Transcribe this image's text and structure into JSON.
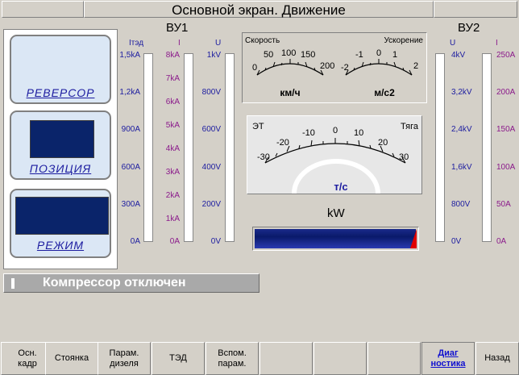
{
  "header": {
    "title": "Основной экран. Движение"
  },
  "left_panel": {
    "reverser_label": "РЕВЕРСОР",
    "position_label": "ПОЗИЦИЯ",
    "mode_label": "РЕЖИМ"
  },
  "vu1": {
    "title": "ВУ1",
    "col_ited": "Iтэд",
    "col_i": "I",
    "col_u": "U",
    "ited_scale": [
      "1,5kA",
      "1,2kA",
      "900A",
      "600A",
      "300A",
      "0A"
    ],
    "i_scale": [
      "8kA",
      "7kA",
      "6kA",
      "5kA",
      "4kA",
      "3kA",
      "2kA",
      "1kA",
      "0A"
    ],
    "u_scale": [
      "1kV",
      "800V",
      "600V",
      "400V",
      "200V",
      "0V"
    ]
  },
  "vu2": {
    "title": "ВУ2",
    "col_u": "U",
    "col_i": "I",
    "u_scale": [
      "4kV",
      "3,2kV",
      "2,4kV",
      "1,6kV",
      "800V",
      "0V"
    ],
    "i_scale": [
      "250A",
      "200A",
      "150A",
      "100A",
      "50A",
      "0A"
    ]
  },
  "speed_gauge": {
    "title": "Скорость",
    "ticks": [
      "0",
      "50",
      "100",
      "150",
      "200"
    ],
    "unit": "км/ч"
  },
  "accel_gauge": {
    "title": "Ускорение",
    "ticks": [
      "-2",
      "-1",
      "0",
      "1",
      "2"
    ],
    "unit": "м/с2"
  },
  "traction_gauge": {
    "left_label": "ЭТ",
    "right_label": "Тяга",
    "ticks": [
      "-30",
      "-20",
      "-10",
      "0",
      "10",
      "20",
      "30"
    ],
    "unit": "т/с"
  },
  "power": {
    "title": "kW",
    "bar_fill": 1.0
  },
  "status": {
    "text": "Компрессор отключен"
  },
  "function_keys": [
    "Осн.\nкадр",
    "Стоянка",
    "Парам.\nдизеля",
    "ТЭД",
    "Вспом.\nпарам.",
    "",
    "",
    "",
    "Диаг\nностика",
    "Назад"
  ],
  "colors": {
    "navy": "#0a246a",
    "scale_blue": "#1c1ca0",
    "scale_magenta": "#8b1a8b",
    "accent_red": "#e00000"
  }
}
